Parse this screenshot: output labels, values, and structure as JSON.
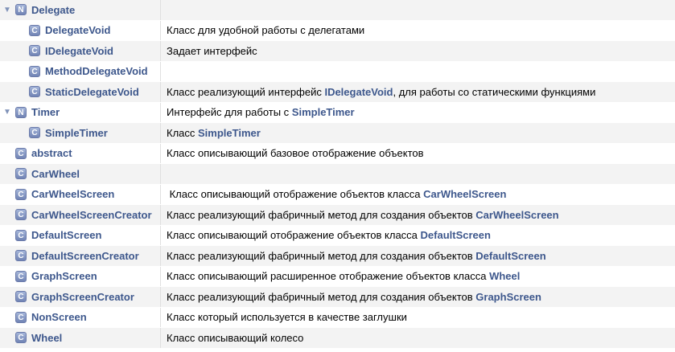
{
  "colors": {
    "link": "#3d578c",
    "row_odd": "#f3f3f3",
    "row_even": "#ffffff",
    "badge": "#7184b4"
  },
  "rows": [
    {
      "kind": "N",
      "depth": 0,
      "expandable": true,
      "name": "Delegate",
      "desc": []
    },
    {
      "kind": "C",
      "depth": 1,
      "expandable": false,
      "name": "DelegateVoid",
      "desc": [
        {
          "t": "Класс для удобной работы с делегатами"
        }
      ]
    },
    {
      "kind": "C",
      "depth": 1,
      "expandable": false,
      "name": "IDelegateVoid",
      "desc": [
        {
          "t": "Задает интерфейс"
        }
      ]
    },
    {
      "kind": "C",
      "depth": 1,
      "expandable": false,
      "name": "MethodDelegateVoid",
      "desc": []
    },
    {
      "kind": "C",
      "depth": 1,
      "expandable": false,
      "name": "StaticDelegateVoid",
      "desc": [
        {
          "t": "Класс реализующий интерфейс "
        },
        {
          "t": "IDelegateVoid",
          "link": true
        },
        {
          "t": ", для работы со статическими функциями"
        }
      ]
    },
    {
      "kind": "N",
      "depth": 0,
      "expandable": true,
      "name": "Timer",
      "desc": [
        {
          "t": "Интерфейс для работы с "
        },
        {
          "t": "SimpleTimer",
          "link": true
        }
      ]
    },
    {
      "kind": "C",
      "depth": 1,
      "expandable": false,
      "name": "SimpleTimer",
      "desc": [
        {
          "t": "Класс "
        },
        {
          "t": "SimpleTimer",
          "link": true
        }
      ]
    },
    {
      "kind": "C",
      "depth": 0,
      "expandable": false,
      "name": "abstract",
      "desc": [
        {
          "t": "Класс описывающий базовое отображение объектов"
        }
      ]
    },
    {
      "kind": "C",
      "depth": 0,
      "expandable": false,
      "name": "CarWheel",
      "desc": []
    },
    {
      "kind": "C",
      "depth": 0,
      "expandable": false,
      "name": "CarWheelScreen",
      "desc": [
        {
          "t": " Класс описывающий отображение объектов класса "
        },
        {
          "t": "CarWheelScreen",
          "link": true
        }
      ]
    },
    {
      "kind": "C",
      "depth": 0,
      "expandable": false,
      "name": "CarWheelScreenCreator",
      "desc": [
        {
          "t": "Класс реализующий фабричный метод для создания объектов "
        },
        {
          "t": "CarWheelScreen",
          "link": true
        }
      ]
    },
    {
      "kind": "C",
      "depth": 0,
      "expandable": false,
      "name": "DefaultScreen",
      "desc": [
        {
          "t": "Класс описывающий отображение объектов класса "
        },
        {
          "t": "DefaultScreen",
          "link": true
        }
      ]
    },
    {
      "kind": "C",
      "depth": 0,
      "expandable": false,
      "name": "DefaultScreenCreator",
      "desc": [
        {
          "t": "Класс реализующий фабричный метод для создания объектов "
        },
        {
          "t": "DefaultScreen",
          "link": true
        }
      ]
    },
    {
      "kind": "C",
      "depth": 0,
      "expandable": false,
      "name": "GraphScreen",
      "desc": [
        {
          "t": "Класс описывающий расширенное отображение объектов класса "
        },
        {
          "t": "Wheel",
          "link": true
        }
      ]
    },
    {
      "kind": "C",
      "depth": 0,
      "expandable": false,
      "name": "GraphScreenCreator",
      "desc": [
        {
          "t": "Класс реализующий фабричный метод для создания объектов "
        },
        {
          "t": "GraphScreen",
          "link": true
        }
      ]
    },
    {
      "kind": "C",
      "depth": 0,
      "expandable": false,
      "name": "NonScreen",
      "desc": [
        {
          "t": "Класс который используется в качестве заглушки"
        }
      ]
    },
    {
      "kind": "C",
      "depth": 0,
      "expandable": false,
      "name": "Wheel",
      "desc": [
        {
          "t": "Класс описывающий колесо"
        }
      ]
    }
  ]
}
